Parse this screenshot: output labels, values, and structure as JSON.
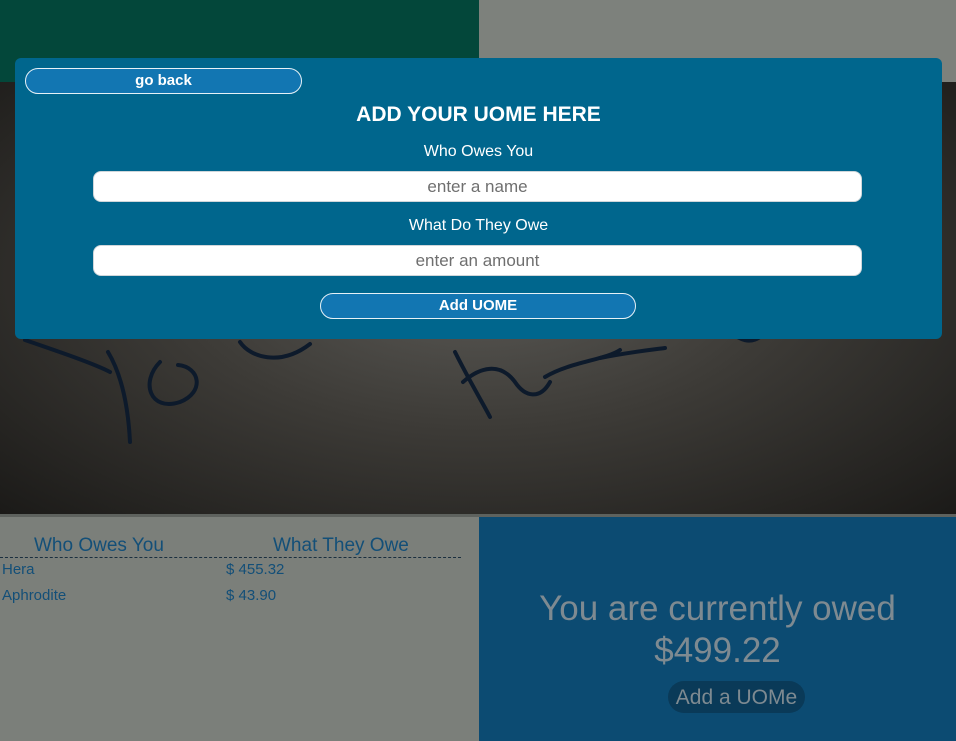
{
  "modal": {
    "back_label": "go back",
    "title": "ADD YOUR UOME HERE",
    "who_label": "Who Owes You",
    "name_placeholder": "enter a name",
    "what_label": "What Do They Owe",
    "amount_placeholder": "enter an amount",
    "submit_label": "Add UOME"
  },
  "table": {
    "headers": [
      "Who Owes You",
      "What They Owe"
    ],
    "rows": [
      {
        "name": "Hera",
        "amount": "$ 455.32"
      },
      {
        "name": "Aphrodite",
        "amount": "$ 43.90"
      }
    ]
  },
  "summary": {
    "owed_text": "You are currently owed",
    "total": "$499.22",
    "add_label": "Add a UOMe"
  },
  "colors": {
    "modal_bg": "#00668d",
    "button_bg": "#1276b2",
    "summary_bg": "#0c4b72",
    "table_text": "#134f78"
  }
}
